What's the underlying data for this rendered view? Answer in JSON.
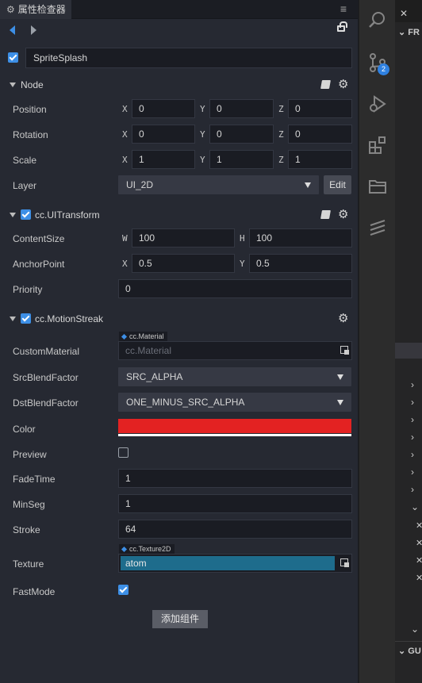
{
  "inspector": {
    "tab_title": "属性检查器",
    "menu_icon": "≡",
    "node_name": "SpriteSplash",
    "node_section": {
      "title": "Node",
      "position": {
        "label": "Position",
        "x": "0",
        "y": "0",
        "z": "0"
      },
      "rotation": {
        "label": "Rotation",
        "x": "0",
        "y": "0",
        "z": "0"
      },
      "scale": {
        "label": "Scale",
        "x": "1",
        "y": "1",
        "z": "1"
      },
      "layer": {
        "label": "Layer",
        "value": "UI_2D",
        "edit_label": "Edit"
      }
    },
    "uitransform": {
      "title": "cc.UITransform",
      "content_size": {
        "label": "ContentSize",
        "w": "100",
        "h": "100"
      },
      "anchor_point": {
        "label": "AnchorPoint",
        "x": "0.5",
        "y": "0.5"
      },
      "priority": {
        "label": "Priority",
        "value": "0"
      }
    },
    "motion_streak": {
      "title": "cc.MotionStreak",
      "custom_material": {
        "label": "CustomMaterial",
        "type_tag": "cc.Material",
        "placeholder": "cc.Material"
      },
      "src_blend": {
        "label": "SrcBlendFactor",
        "value": "SRC_ALPHA"
      },
      "dst_blend": {
        "label": "DstBlendFactor",
        "value": "ONE_MINUS_SRC_ALPHA"
      },
      "color": {
        "label": "Color",
        "value": "#e32222"
      },
      "preview": {
        "label": "Preview",
        "checked": false
      },
      "fade_time": {
        "label": "FadeTime",
        "value": "1"
      },
      "min_seg": {
        "label": "MinSeg",
        "value": "1"
      },
      "stroke": {
        "label": "Stroke",
        "value": "64"
      },
      "texture": {
        "label": "Texture",
        "type_tag": "cc.Texture2D",
        "value": "atom"
      },
      "fast_mode": {
        "label": "FastMode",
        "checked": true
      }
    },
    "axis_labels": {
      "x": "X",
      "y": "Y",
      "z": "Z",
      "w": "W",
      "h": "H"
    },
    "add_component_label": "添加组件"
  },
  "activity_bar": {
    "source_control_badge": "2",
    "icons": [
      "search-icon",
      "source-control-icon",
      "debug-icon",
      "extensions-icon",
      "folder-icon",
      "cocos-icon"
    ]
  },
  "explorer": {
    "tab_label": "✕",
    "section_header": "FR",
    "bottom_header": "GU"
  },
  "colors": {
    "accent": "#3d8fe6",
    "texture_highlight": "#1e6c8c"
  }
}
